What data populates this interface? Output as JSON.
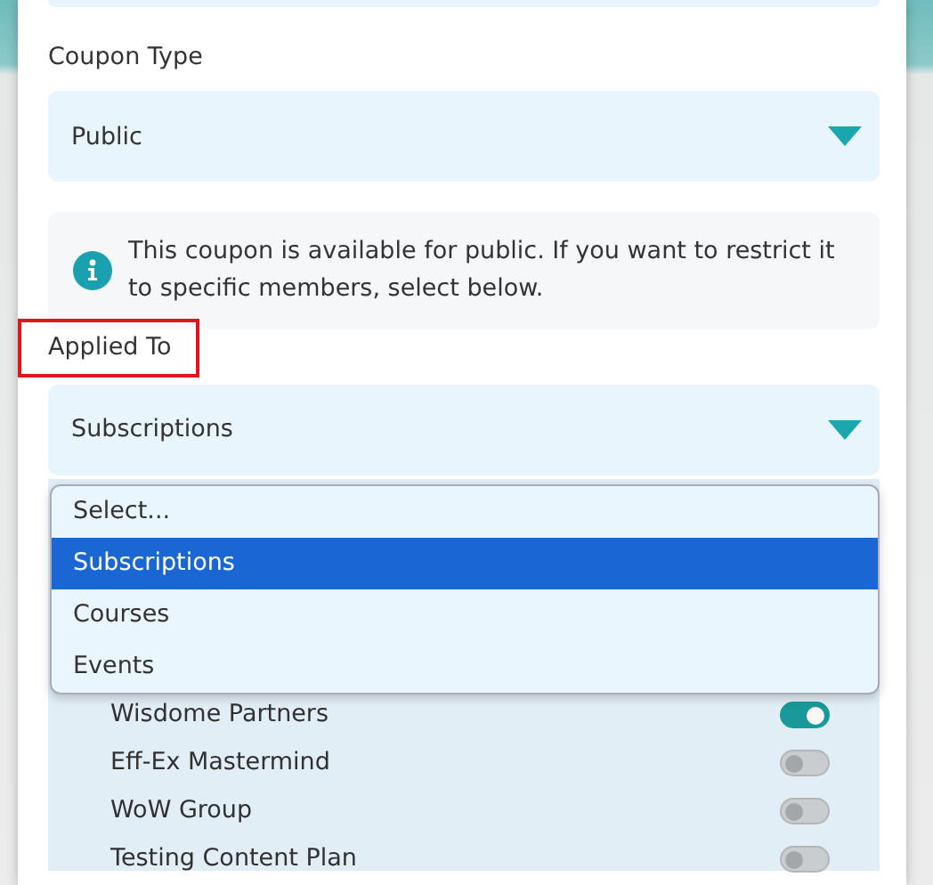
{
  "coupon_type": {
    "label": "Coupon Type",
    "value": "Public"
  },
  "info": {
    "text": "This coupon is available for public. If you want to restrict it to specific members, select below."
  },
  "applied_to": {
    "label": "Applied To",
    "highlighted": true,
    "value": "Subscriptions",
    "options": [
      {
        "label": "Select...",
        "selected": false
      },
      {
        "label": "Subscriptions",
        "selected": true
      },
      {
        "label": "Courses",
        "selected": false
      },
      {
        "label": "Events",
        "selected": false
      }
    ]
  },
  "members": [
    {
      "name": "Wisdome Partners",
      "on": true
    },
    {
      "name": "Eff-Ex Mastermind",
      "on": false
    },
    {
      "name": "WoW Group",
      "on": false
    },
    {
      "name": "Testing Content Plan",
      "on": false
    }
  ]
}
